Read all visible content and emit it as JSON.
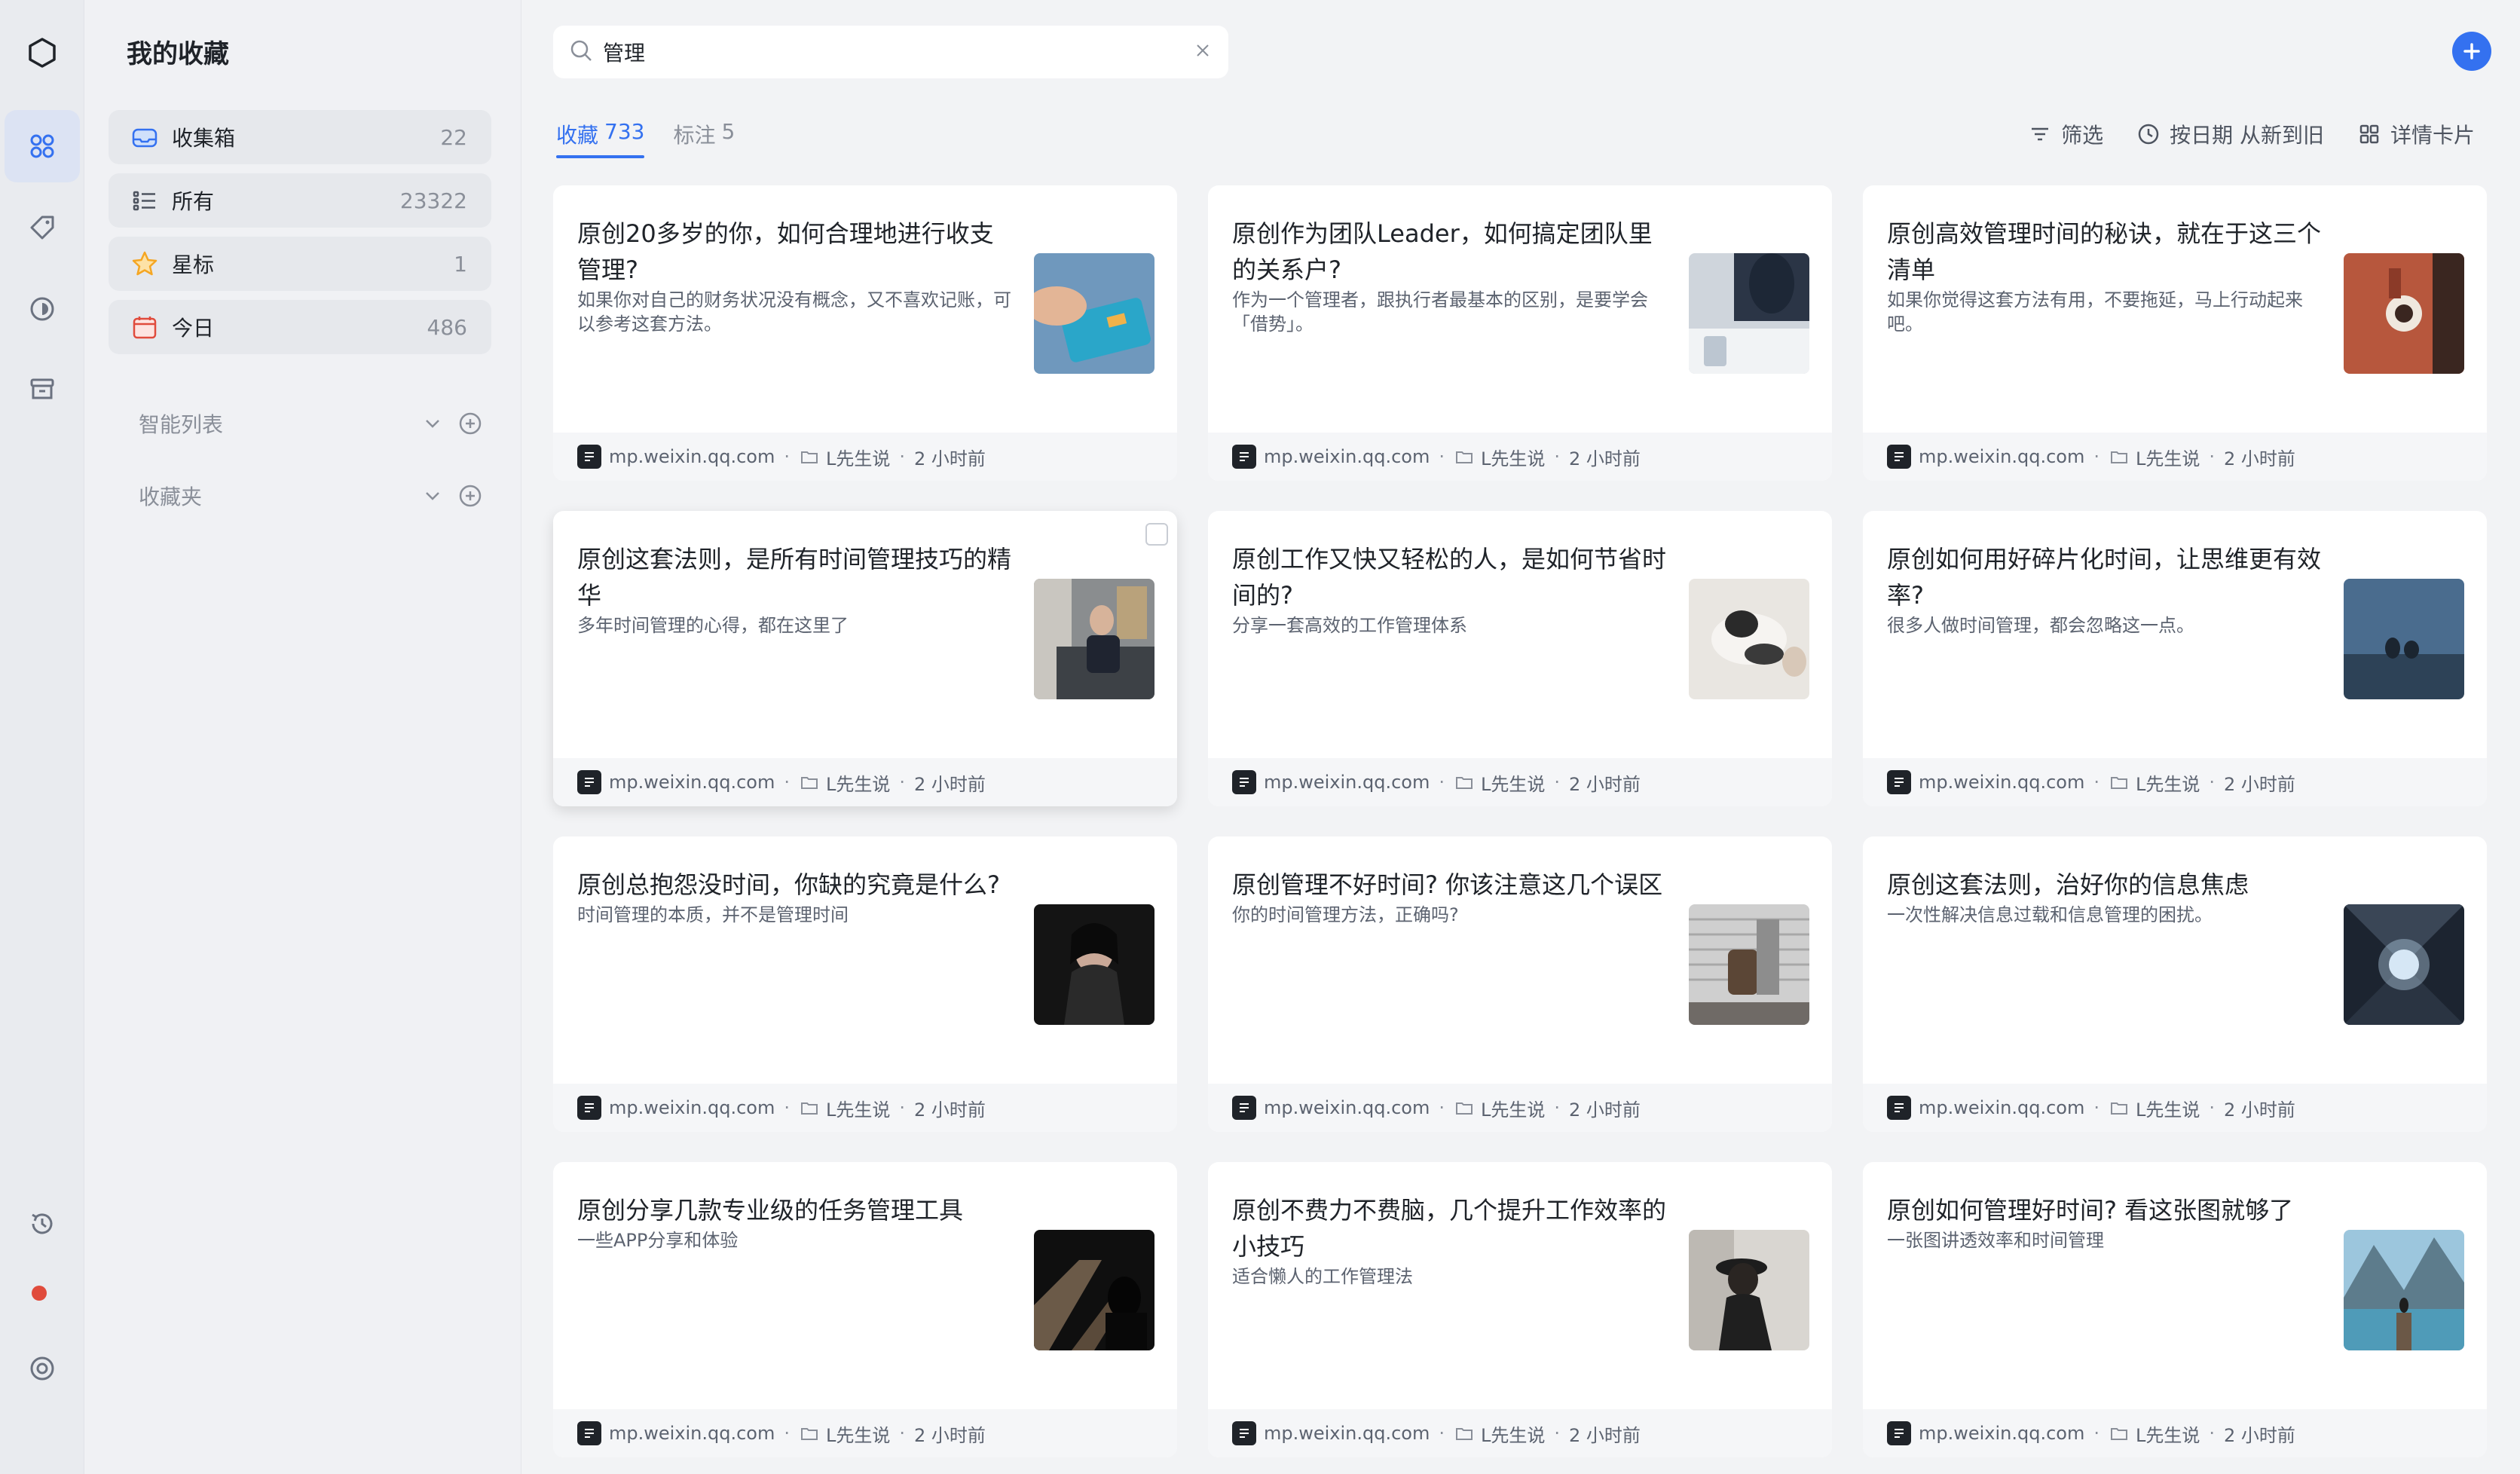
{
  "sidebar": {
    "title": "我的收藏",
    "items": [
      {
        "label": "收集箱",
        "count": "22",
        "icon": "inbox-icon"
      },
      {
        "label": "所有",
        "count": "23322",
        "icon": "list-icon"
      },
      {
        "label": "星标",
        "count": "1",
        "icon": "star-icon"
      },
      {
        "label": "今日",
        "count": "486",
        "icon": "calendar-icon"
      }
    ],
    "sections": [
      {
        "label": "智能列表"
      },
      {
        "label": "收藏夹"
      }
    ]
  },
  "search": {
    "value": "管理",
    "placeholder": ""
  },
  "tabs": [
    {
      "label": "收藏",
      "count": "733"
    },
    {
      "label": "标注",
      "count": "5"
    }
  ],
  "toolbar": {
    "filter_label": "筛选",
    "sort_label": "按日期 从新到旧",
    "view_label": "详情卡片"
  },
  "colors": {
    "accent": "#3471f0",
    "star": "#f5a623",
    "calendar": "#e04b3c"
  },
  "cards": [
    {
      "title": "原创20多岁的你，如何合理地进行收支管理?",
      "desc": "如果你对自己的财务状况没有概念，又不喜欢记账，可以参考这套方法。",
      "source": "mp.weixin.qq.com",
      "folder": "L先生说",
      "time": "2 小时前"
    },
    {
      "title": "原创作为团队Leader，如何搞定团队里的关系户?",
      "desc": "作为一个管理者，跟执行者最基本的区别，是要学会「借势」。",
      "source": "mp.weixin.qq.com",
      "folder": "L先生说",
      "time": "2 小时前"
    },
    {
      "title": "原创高效管理时间的秘诀，就在于这三个清单",
      "desc": "如果你觉得这套方法有用，不要拖延，马上行动起来吧。",
      "source": "mp.weixin.qq.com",
      "folder": "L先生说",
      "time": "2 小时前"
    },
    {
      "title": "原创这套法则，是所有时间管理技巧的精华",
      "desc": "多年时间管理的心得，都在这里了",
      "source": "mp.weixin.qq.com",
      "folder": "L先生说",
      "time": "2 小时前"
    },
    {
      "title": "原创工作又快又轻松的人，是如何节省时间的?",
      "desc": "分享一套高效的工作管理体系",
      "source": "mp.weixin.qq.com",
      "folder": "L先生说",
      "time": "2 小时前"
    },
    {
      "title": "原创如何用好碎片化时间，让思维更有效率?",
      "desc": "很多人做时间管理，都会忽略这一点。",
      "source": "mp.weixin.qq.com",
      "folder": "L先生说",
      "time": "2 小时前"
    },
    {
      "title": "原创总抱怨没时间，你缺的究竟是什么?",
      "desc": "时间管理的本质，并不是管理时间",
      "source": "mp.weixin.qq.com",
      "folder": "L先生说",
      "time": "2 小时前"
    },
    {
      "title": "原创管理不好时间? 你该注意这几个误区",
      "desc": "你的时间管理方法，正确吗?",
      "source": "mp.weixin.qq.com",
      "folder": "L先生说",
      "time": "2 小时前"
    },
    {
      "title": "原创这套法则，治好你的信息焦虑",
      "desc": "一次性解决信息过载和信息管理的困扰。",
      "source": "mp.weixin.qq.com",
      "folder": "L先生说",
      "time": "2 小时前"
    },
    {
      "title": "原创分享几款专业级的任务管理工具",
      "desc": "一些APP分享和体验",
      "source": "mp.weixin.qq.com",
      "folder": "L先生说",
      "time": "2 小时前"
    },
    {
      "title": "原创不费力不费脑，几个提升工作效率的小技巧",
      "desc": "适合懒人的工作管理法",
      "source": "mp.weixin.qq.com",
      "folder": "L先生说",
      "time": "2 小时前"
    },
    {
      "title": "原创如何管理好时间? 看这张图就够了",
      "desc": "一张图讲透效率和时间管理",
      "source": "mp.weixin.qq.com",
      "folder": "L先生说",
      "time": "2 小时前"
    }
  ]
}
